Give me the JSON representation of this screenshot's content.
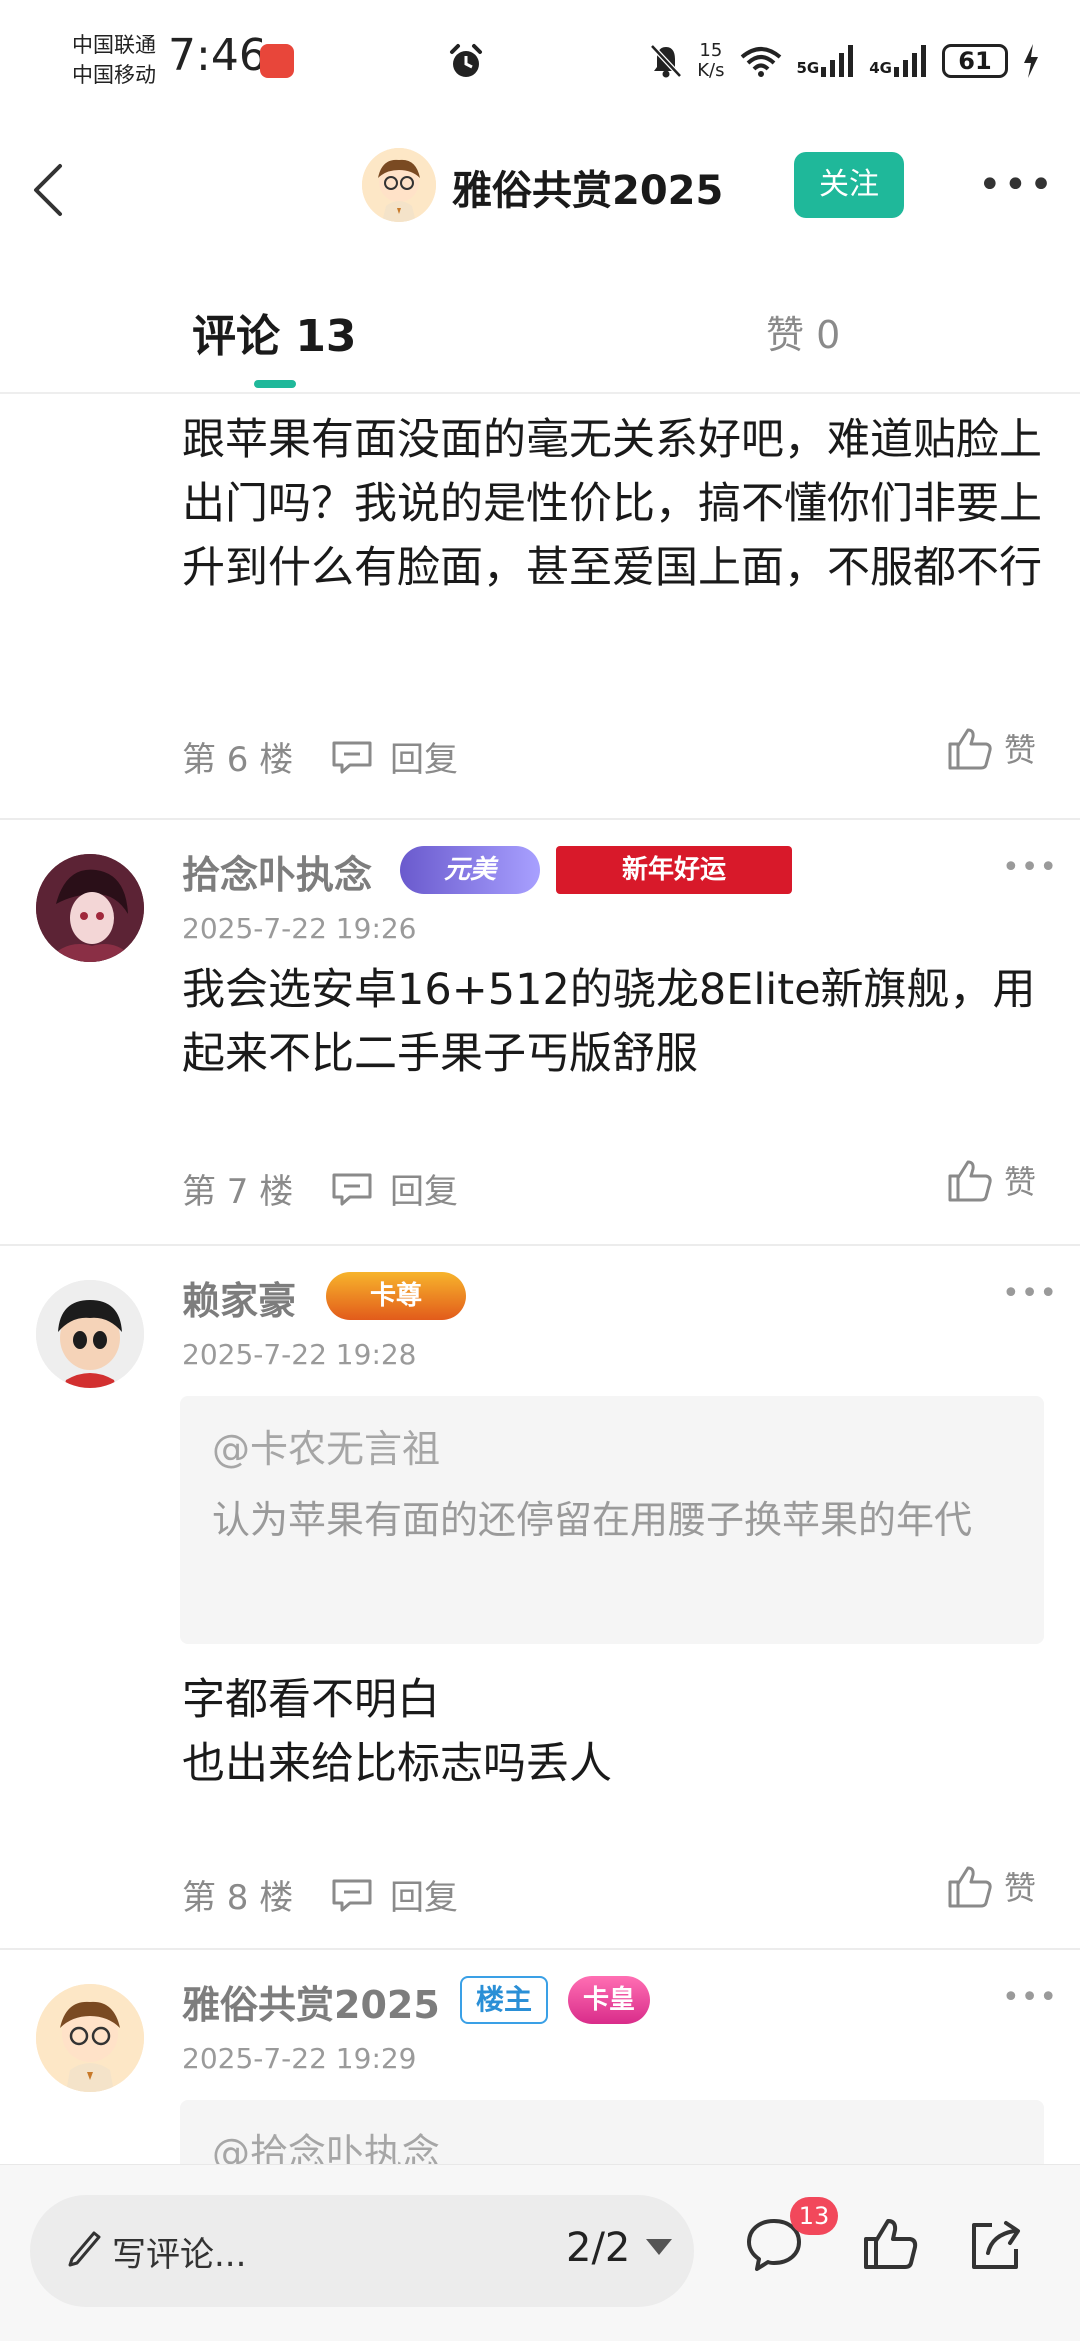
{
  "status_bar": {
    "carrier_1": "中国联通",
    "carrier_2": "中国移动",
    "time": "7:46",
    "net_speed_value": "15",
    "net_speed_unit": "K/s",
    "signal_1": "5G",
    "signal_2": "4G",
    "battery": "61"
  },
  "header": {
    "title": "雅俗共赏2025",
    "follow_label": "关注",
    "more_icon": "more-icon"
  },
  "tabs": {
    "comments_label": "评论 13",
    "likes_label": "赞 0",
    "accent_color": "#1fb89a"
  },
  "posts": [
    {
      "body": "跟苹果有面没面的毫无关系好吧，难道贴脸上出门吗？我说的是性价比，搞不懂你们非要上升到什么有脸面，甚至爱国上面，不服都不行",
      "floor": "第 6 楼",
      "reply_label": "回复",
      "like_label": "赞"
    },
    {
      "username": "拾念卟执念",
      "badge_1": "元美",
      "badge_2": "新年好运",
      "timestamp": "2025-7-22 19:26",
      "body": "我会选安卓16+512的骁龙8Elite新旗舰，用起来不比二手果子丐版舒服",
      "floor": "第 7 楼",
      "reply_label": "回复",
      "like_label": "赞"
    },
    {
      "username": "赖家豪",
      "badge_1": "卡尊",
      "timestamp": "2025-7-22 19:28",
      "quote_user": "@卡农无言祖",
      "quote_text": "认为苹果有面的还停留在用腰子换苹果的年代",
      "body_line_1": "字都看不明白",
      "body_line_2": "也出来给比标志吗丢人",
      "floor": "第 8 楼",
      "reply_label": "回复",
      "like_label": "赞"
    },
    {
      "username": "雅俗共赏2025",
      "badge_1": "楼主",
      "badge_2": "卡皇",
      "timestamp": "2025-7-22 19:29",
      "quote_user_partial": "@拾念卟执念"
    }
  ],
  "bottom_bar": {
    "composer_placeholder": "写评论...",
    "pager": "2/2",
    "comment_count": "13"
  }
}
